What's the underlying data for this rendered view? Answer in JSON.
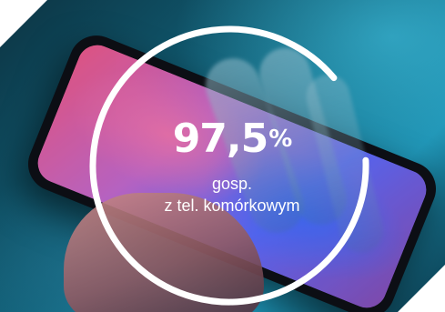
{
  "stat": {
    "value": "97,5",
    "unit": "%",
    "label_line1": "gosp.",
    "label_line2": "z tel. komórkowym",
    "ring_progress": 0.975
  },
  "colors": {
    "ring": "#ffffff",
    "text": "#ffffff",
    "background_teal": "#1c8fb0"
  }
}
